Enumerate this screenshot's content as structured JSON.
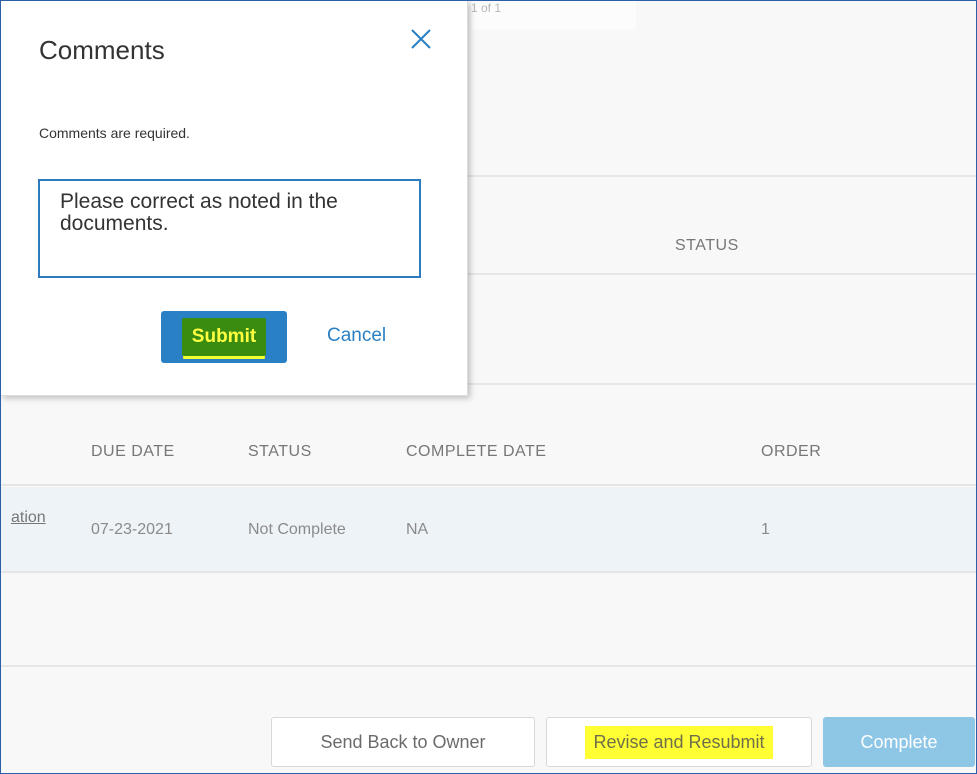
{
  "pager": {
    "text": "1 of 1"
  },
  "upper_table": {
    "status_header": "STATUS"
  },
  "lower_table": {
    "headers": [
      "DUE DATE",
      "STATUS",
      "COMPLETE DATE",
      "ORDER"
    ],
    "rows": [
      {
        "link_fragment": "ation",
        "due_date": "07-23-2021",
        "status": "Not Complete",
        "complete_date": "NA",
        "order": "1"
      }
    ]
  },
  "actions": {
    "send_back": "Send Back to Owner",
    "revise": "Revise and Resubmit",
    "complete": "Complete"
  },
  "modal": {
    "title": "Comments",
    "message": "Comments are required.",
    "comment_value": "Please correct as noted in the documents.",
    "submit": "Submit",
    "cancel": "Cancel",
    "close_icon": "close-icon"
  },
  "colors": {
    "accent": "#2a80c4",
    "highlight_yellow": "#ffff33",
    "highlight_green": "#3a8c10",
    "complete_button": "#8ec6e6"
  }
}
